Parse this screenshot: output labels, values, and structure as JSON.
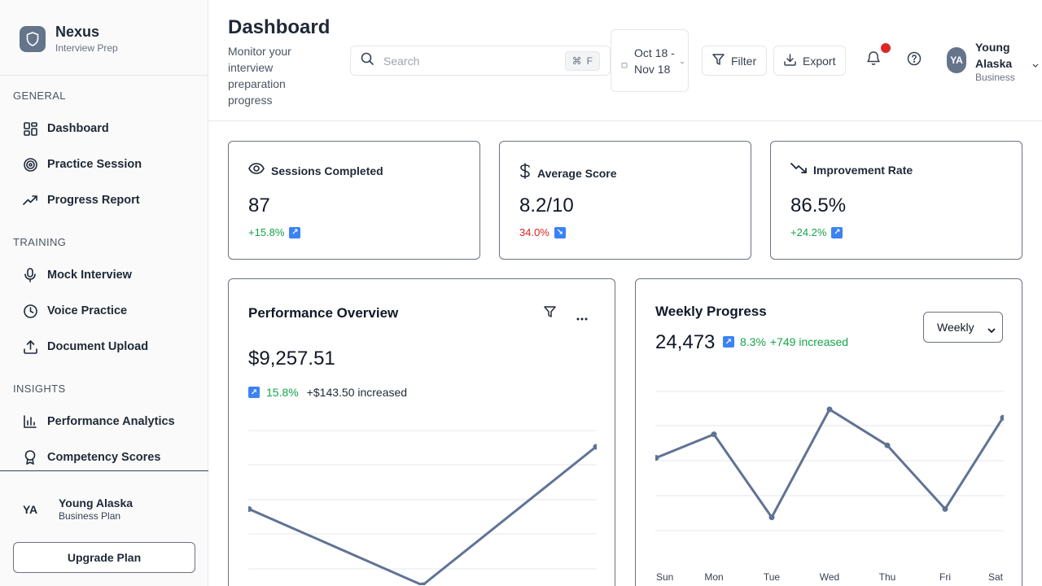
{
  "brand": {
    "name": "Nexus",
    "subtitle": "Interview Prep"
  },
  "sidebar": {
    "sections": [
      {
        "label": "GENERAL",
        "items": [
          {
            "label": "Dashboard",
            "icon": "grid-icon"
          },
          {
            "label": "Practice Session",
            "icon": "target-icon"
          },
          {
            "label": "Progress Report",
            "icon": "trending-up-icon"
          }
        ]
      },
      {
        "label": "TRAINING",
        "items": [
          {
            "label": "Mock Interview",
            "icon": "mic-icon"
          },
          {
            "label": "Voice Practice",
            "icon": "clock-icon"
          },
          {
            "label": "Document Upload",
            "icon": "upload-icon"
          }
        ]
      },
      {
        "label": "INSIGHTS",
        "items": [
          {
            "label": "Performance Analytics",
            "icon": "bar-chart-icon"
          },
          {
            "label": "Competency Scores",
            "icon": "award-icon"
          }
        ]
      }
    ],
    "user": {
      "initials": "YA",
      "name": "Young Alaska",
      "plan": "Business Plan"
    },
    "upgrade_label": "Upgrade Plan"
  },
  "header": {
    "title": "Dashboard",
    "subtitle": "Monitor your interview preparation progress",
    "search": {
      "placeholder": "Search",
      "shortcut_symbol": "⌘",
      "shortcut_key": "F"
    },
    "date_range": "Oct 18 - Nov 18",
    "filter_label": "Filter",
    "export_label": "Export",
    "user": {
      "initials": "YA",
      "name": "Young Alaska",
      "plan": "Business"
    }
  },
  "stats": [
    {
      "label": "Sessions Completed",
      "icon": "eye-icon",
      "value": "87",
      "change": "+15.8%",
      "trend": "up"
    },
    {
      "label": "Average Score",
      "icon": "dollar-icon",
      "value": "8.2/10",
      "change": "34.0%",
      "trend": "down"
    },
    {
      "label": "Improvement Rate",
      "icon": "trending-down-icon",
      "value": "86.5%",
      "change": "+24.2%",
      "trend": "up"
    }
  ],
  "performance": {
    "title": "Performance Overview",
    "value": "$9,257.51",
    "change_pct": "15.8%",
    "change_text": "+$143.50 increased"
  },
  "weekly": {
    "title": "Weekly Progress",
    "value": "24,473",
    "change_pct": "8.3%",
    "change_text": "+749 increased",
    "period": "Weekly"
  },
  "colors": {
    "accent": "#64748b",
    "line": "#5f7394",
    "up": "#16a34a",
    "down": "#dc2626",
    "badge": "#3b82f6"
  },
  "chart_data": [
    {
      "type": "line",
      "title": "Performance Overview",
      "x": [
        0,
        1,
        2
      ],
      "values": [
        0.55,
        0.0,
        1.0
      ]
    },
    {
      "type": "line",
      "title": "Weekly Progress",
      "categories": [
        "Sun",
        "Mon",
        "Tue",
        "Wed",
        "Thu",
        "Fri",
        "Sat"
      ],
      "values": [
        0.65,
        0.82,
        0.22,
        1.0,
        0.74,
        0.28,
        0.94
      ]
    }
  ]
}
